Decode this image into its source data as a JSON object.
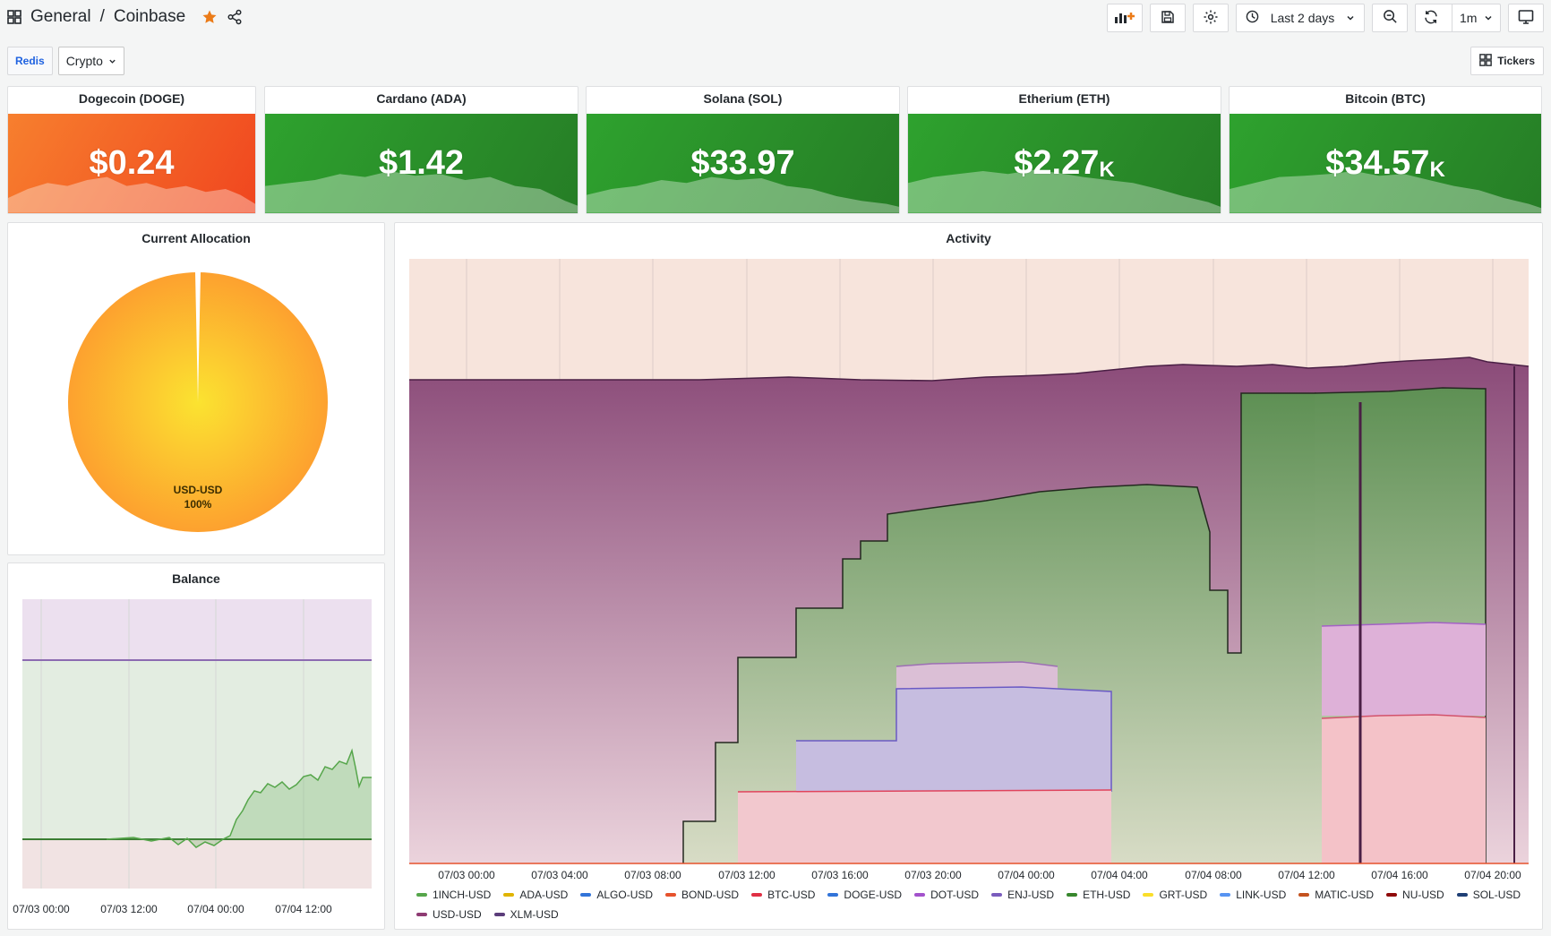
{
  "header": {
    "folder": "General",
    "separator": "/",
    "dashboard": "Coinbase",
    "time_range": "Last 2 days",
    "refresh_interval": "1m"
  },
  "variables": {
    "datasource_label": "Redis",
    "crypto_value": "Crypto",
    "tickers_label": "Tickers"
  },
  "stats": [
    {
      "title": "Dogecoin (DOGE)",
      "value": "$0.24",
      "unit": "",
      "color": "#f4541f"
    },
    {
      "title": "Cardano (ADA)",
      "value": "$1.42",
      "unit": "",
      "color": "#2f9d2f"
    },
    {
      "title": "Solana (SOL)",
      "value": "$33.97",
      "unit": "",
      "color": "#2f9d2f"
    },
    {
      "title": "Etherium (ETH)",
      "value": "$2.27",
      "unit": "K",
      "color": "#2f9d2f"
    },
    {
      "title": "Bitcoin (BTC)",
      "value": "$34.57",
      "unit": "K",
      "color": "#2f9d2f"
    }
  ],
  "allocation": {
    "title": "Current Allocation",
    "slice_label": "USD-USD",
    "slice_percent": "100%",
    "chart_data": {
      "type": "pie",
      "categories": [
        "USD-USD"
      ],
      "values": [
        100
      ]
    }
  },
  "balance": {
    "title": "Balance",
    "x_ticks": [
      "07/03 00:00",
      "07/03 12:00",
      "07/04 00:00",
      "07/04 12:00"
    ]
  },
  "activity": {
    "title": "Activity",
    "x_ticks": [
      "07/03 00:00",
      "07/03 04:00",
      "07/03 08:00",
      "07/03 12:00",
      "07/03 16:00",
      "07/03 20:00",
      "07/04 00:00",
      "07/04 04:00",
      "07/04 08:00",
      "07/04 12:00",
      "07/04 16:00",
      "07/04 20:00"
    ],
    "legend": [
      {
        "name": "1INCH-USD",
        "color": "#56a64b"
      },
      {
        "name": "ADA-USD",
        "color": "#e0b400"
      },
      {
        "name": "ALGO-USD",
        "color": "#3274d9"
      },
      {
        "name": "BOND-USD",
        "color": "#e6522c"
      },
      {
        "name": "BTC-USD",
        "color": "#e02f44"
      },
      {
        "name": "DOGE-USD",
        "color": "#3274d9"
      },
      {
        "name": "DOT-USD",
        "color": "#a352cc"
      },
      {
        "name": "ENJ-USD",
        "color": "#7a5cbd"
      },
      {
        "name": "ETH-USD",
        "color": "#37872d"
      },
      {
        "name": "GRT-USD",
        "color": "#fade2a"
      },
      {
        "name": "LINK-USD",
        "color": "#5794f2"
      },
      {
        "name": "MATIC-USD",
        "color": "#c4521f"
      },
      {
        "name": "NU-USD",
        "color": "#8f0a0a"
      },
      {
        "name": "SOL-USD",
        "color": "#1f3f75"
      },
      {
        "name": "USD-USD",
        "color": "#8e3b73"
      },
      {
        "name": "XLM-USD",
        "color": "#5b3d7a"
      }
    ]
  }
}
